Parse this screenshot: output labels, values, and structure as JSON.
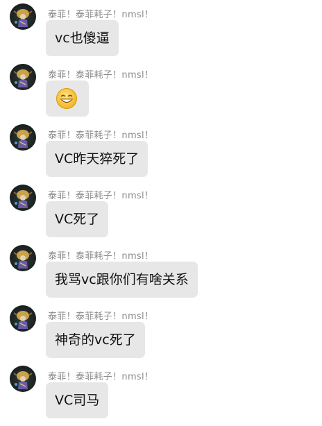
{
  "conversation": {
    "messages": [
      {
        "sender": "泰菲！泰菲耗子！nmsl！",
        "text": "vc也傻逼"
      },
      {
        "sender": "泰菲！泰菲耗子！nmsl！",
        "emoji": "grinning-face-emoji"
      },
      {
        "sender": "泰菲！泰菲耗子！nmsl！",
        "text": "VC昨天猝死了"
      },
      {
        "sender": "泰菲！泰菲耗子！nmsl！",
        "text": "VC死了"
      },
      {
        "sender": "泰菲！泰菲耗子！nmsl！",
        "text": "我骂vc跟你们有啥关系"
      },
      {
        "sender": "泰菲！泰菲耗子！nmsl！",
        "text": "神奇的vc死了"
      },
      {
        "sender": "泰菲！泰菲耗子！nmsl！",
        "text": "VC司马"
      }
    ]
  },
  "colors": {
    "bubble": "#e7e7e7",
    "sender_name": "#8b8b8b",
    "message_text": "#111111",
    "emoji_face": "#f6c23c"
  }
}
